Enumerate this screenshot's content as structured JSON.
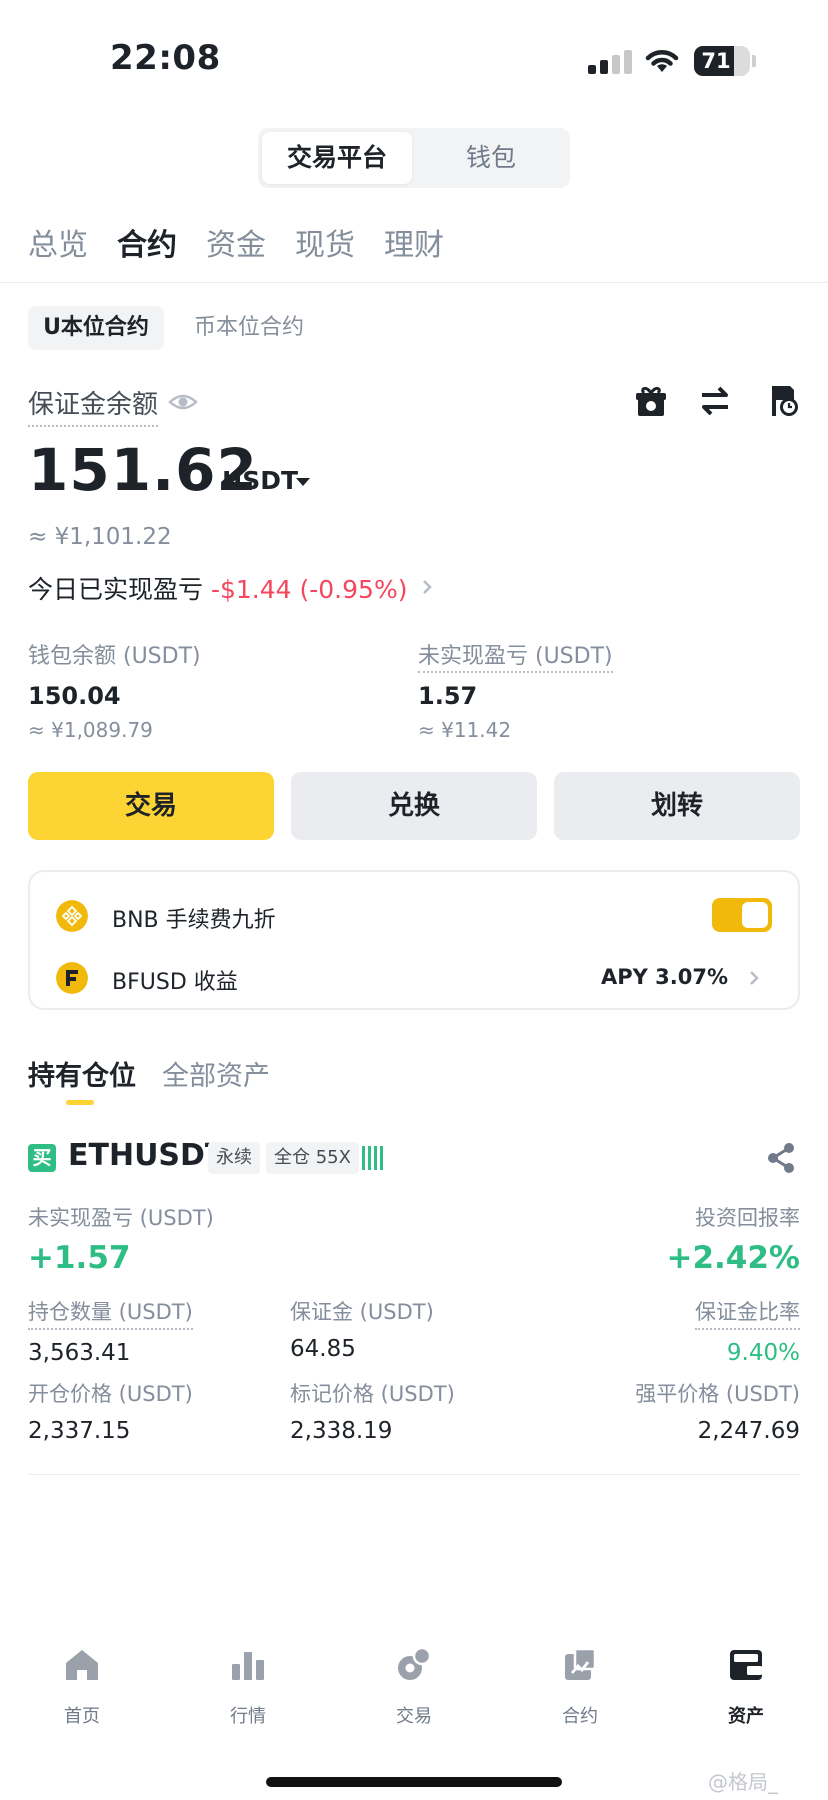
{
  "status_bar": {
    "time": "22:08",
    "battery": "71",
    "battery_level": 0.71
  },
  "segment": {
    "active": "交易平台",
    "other": "钱包"
  },
  "tabs": [
    "总览",
    "合约",
    "资金",
    "现货",
    "理财"
  ],
  "active_tab": "合约",
  "subtabs": [
    "U本位合约",
    "币本位合约"
  ],
  "margin": {
    "label": "保证金余额",
    "amount": "151.62",
    "unit": "USDT",
    "approx": "≈ ¥1,101.22",
    "today_label": "今日已实现盈亏",
    "today_value": "-$1.44 (-0.95%)"
  },
  "stats": {
    "wallet_label": "钱包余额 (USDT)",
    "wallet_value": "150.04",
    "wallet_approx": "≈ ¥1,089.79",
    "unrealized_label": "未实现盈亏 (USDT)",
    "unrealized_value": "1.57",
    "unrealized_approx": "≈ ¥11.42"
  },
  "actions": {
    "trade": "交易",
    "convert": "兑换",
    "transfer": "划转"
  },
  "card": {
    "bnb_label": "BNB 手续费九折",
    "bnb_toggle_on": true,
    "bfusd_label": "BFUSD 收益",
    "bfusd_apy": "APY 3.07%"
  },
  "position_tabs": {
    "active": "持有仓位",
    "other": "全部资产"
  },
  "position": {
    "side": "买",
    "symbol": "ETHUSDT",
    "type_tag": "永续",
    "leverage_tag": "全仓 55X",
    "unrealized_label": "未实现盈亏 (USDT)",
    "unrealized_value": "+1.57",
    "roi_label": "投资回报率",
    "roi_value": "+2.42%",
    "size_label": "持仓数量 (USDT)",
    "size_value": "3,563.41",
    "margin_label": "保证金 (USDT)",
    "margin_value": "64.85",
    "margin_ratio_label": "保证金比率",
    "margin_ratio_value": "9.40%",
    "entry_label": "开仓价格 (USDT)",
    "entry_value": "2,337.15",
    "mark_label": "标记价格 (USDT)",
    "mark_value": "2,338.19",
    "liq_label": "强平价格 (USDT)",
    "liq_value": "2,247.69"
  },
  "bottom_nav": [
    {
      "label": "首页",
      "icon": "home-icon"
    },
    {
      "label": "行情",
      "icon": "chart-icon"
    },
    {
      "label": "交易",
      "icon": "trade-icon"
    },
    {
      "label": "合约",
      "icon": "futures-icon"
    },
    {
      "label": "资产",
      "icon": "wallet-icon"
    }
  ],
  "watermark": "@格局_",
  "colors": {
    "accent": "#fcd535",
    "up": "#2ebd85",
    "down": "#f6465d",
    "text": "#1e2329",
    "muted": "#848e9c"
  }
}
